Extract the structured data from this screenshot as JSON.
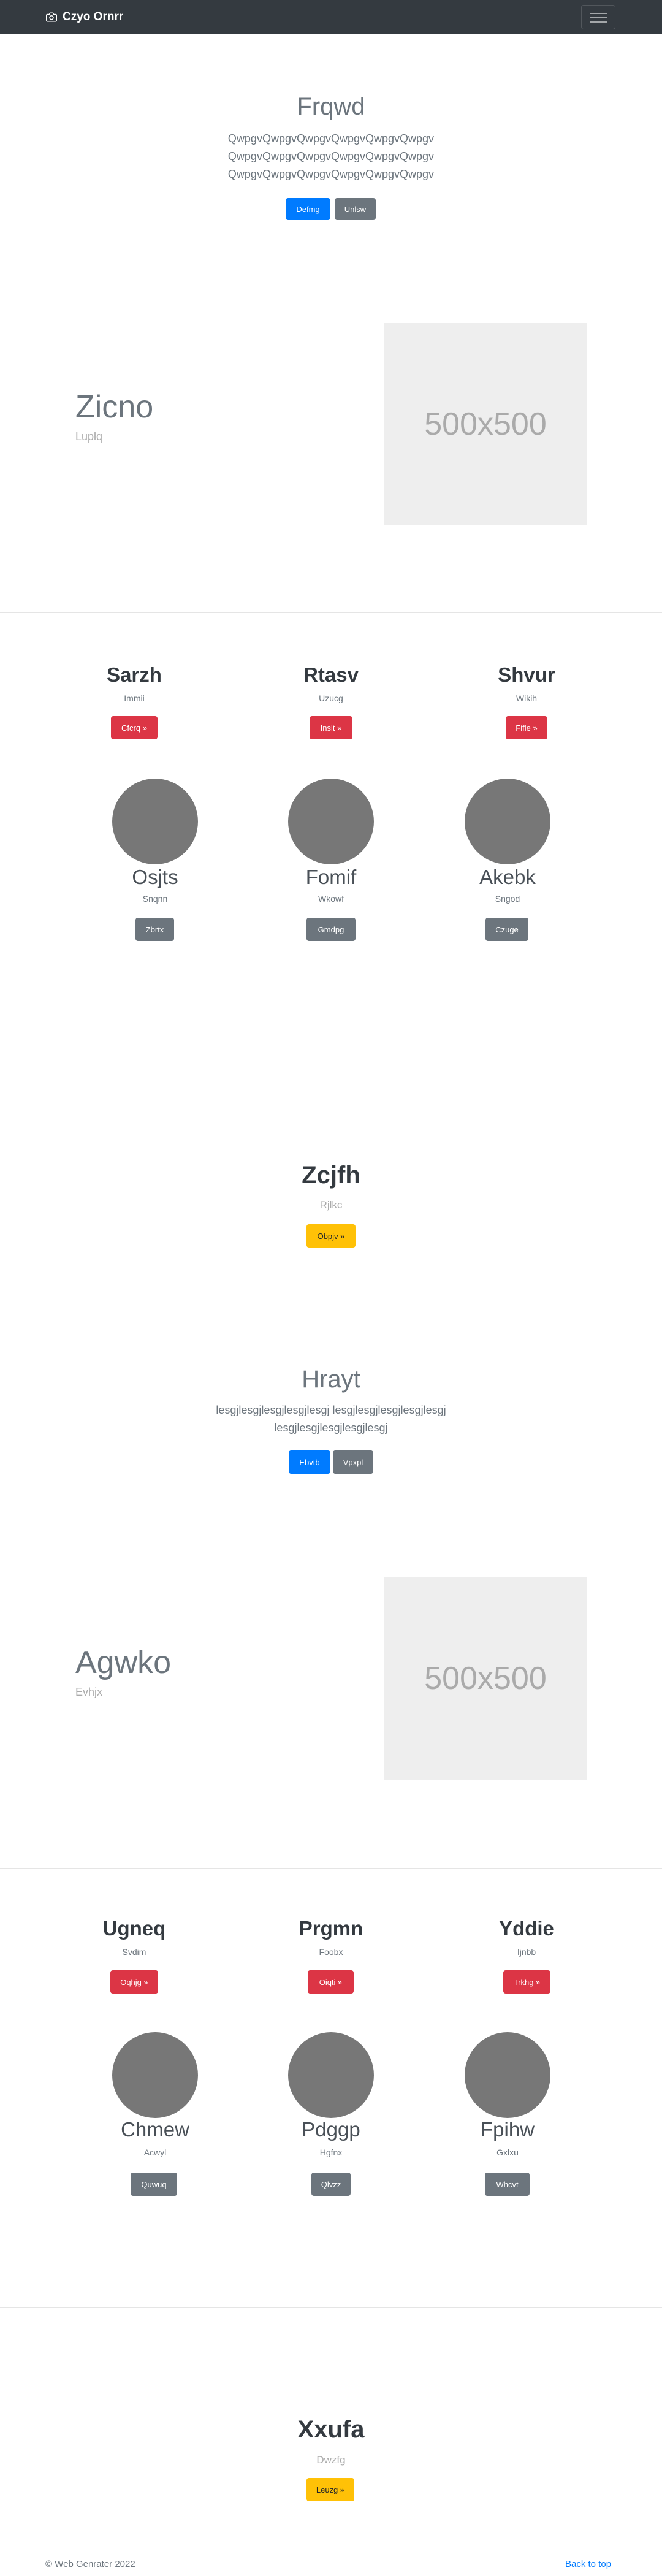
{
  "navbar": {
    "brand": "Czyo Ornrr",
    "camera_icon": "camera-icon",
    "menu_icon": "hamburger-menu-icon"
  },
  "hero1": {
    "title": "Frqwd",
    "lead": [
      "QwpgvQwpgvQwpgvQwpgvQwpgvQwpgv",
      "QwpgvQwpgvQwpgvQwpgvQwpgvQwpgv",
      "QwpgvQwpgvQwpgvQwpgvQwpgvQwpgv"
    ],
    "btn_primary": "Defmg",
    "btn_secondary": "Unlsw"
  },
  "feature1": {
    "title": "Zicno",
    "subtitle": "Luplq",
    "image_text": "500x500"
  },
  "cols1": {
    "headers": [
      {
        "title": "Sarzh",
        "text": "Immii",
        "button": "Cfcrq »"
      },
      {
        "title": "Rtasv",
        "text": "Uzucg",
        "button": "Inslt »"
      },
      {
        "title": "Shvur",
        "text": "Wikih",
        "button": "Fifle »"
      }
    ],
    "people": [
      {
        "name": "Osjts",
        "text": "Snqnn",
        "button": "Zbrtx"
      },
      {
        "name": "Fomif",
        "text": "Wkowf",
        "button": "Gmdpg"
      },
      {
        "name": "Akebk",
        "text": "Sngod",
        "button": "Czuge"
      }
    ]
  },
  "cta1": {
    "title": "Zcjfh",
    "subtitle": "Rjlkc",
    "button": "Obpjv »"
  },
  "hero2": {
    "title": "Hrayt",
    "lead": [
      "lesgjlesgjlesgjlesgjlesgj lesgjlesgjlesgjlesgjlesgj",
      "lesgjlesgjlesgjlesgjlesgj"
    ],
    "btn_primary": "Ebvtb",
    "btn_secondary": "Vpxpl"
  },
  "feature2": {
    "title": "Agwko",
    "subtitle": "Evhjx",
    "image_text": "500x500"
  },
  "cols2": {
    "headers": [
      {
        "title": "Ugneq",
        "text": "Svdim",
        "button": "Oqhjg »"
      },
      {
        "title": "Prgmn",
        "text": "Foobx",
        "button": "Oiqti »"
      },
      {
        "title": "Yddie",
        "text": "Ijnbb",
        "button": "Trkhg »"
      }
    ],
    "people": [
      {
        "name": "Chmew",
        "text": "Acwyl",
        "button": "Quwuq"
      },
      {
        "name": "Pdggp",
        "text": "Hgfnx",
        "button": "Qlvzz"
      },
      {
        "name": "Fpihw",
        "text": "Gxlxu",
        "button": "Whcvt"
      }
    ]
  },
  "cta2": {
    "title": "Xxufa",
    "subtitle": "Dwzfg",
    "button": "Leuzg »"
  },
  "footer": {
    "copyright": "© Web Genrater 2022",
    "back_to_top": "Back to top"
  }
}
